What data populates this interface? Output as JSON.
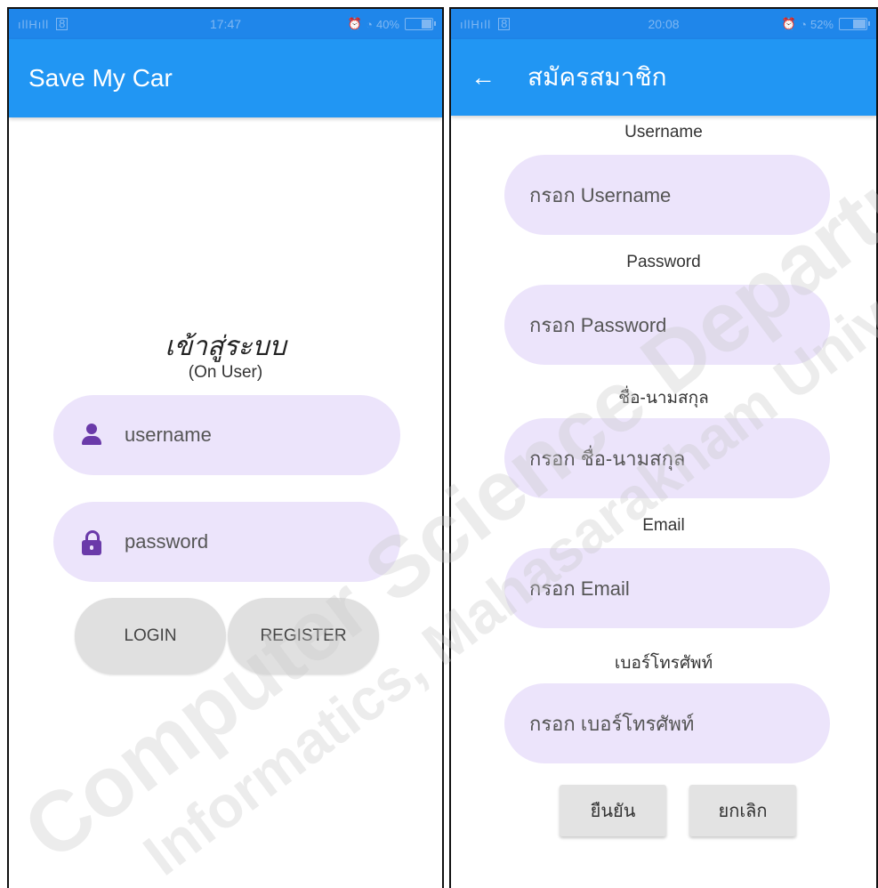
{
  "left_screen": {
    "status": {
      "signal": "H",
      "time": "17:47",
      "battery": "40%",
      "battery_level": 0.4
    },
    "appbar": {
      "title": "Save My Car"
    },
    "login": {
      "heading": "เข้าสู่ระบบ",
      "subheading": "(On User)",
      "username_placeholder": "username",
      "password_placeholder": "password",
      "login_button": "LOGIN",
      "register_button": "REGISTER"
    }
  },
  "right_screen": {
    "status": {
      "signal": "H",
      "time": "20:08",
      "battery": "52%",
      "battery_level": 0.52
    },
    "appbar": {
      "title": "สมัครสมาชิก"
    },
    "fields": [
      {
        "label": "Username",
        "placeholder": "กรอก Username"
      },
      {
        "label": "Password",
        "placeholder": "กรอก Password"
      },
      {
        "label": "ชื่อ-นามสกุล",
        "placeholder": "กรอก ชื่อ-นามสกุล"
      },
      {
        "label": "Email",
        "placeholder": "กรอก Email"
      },
      {
        "label": "เบอร์โทรศัพท์",
        "placeholder": "กรอก เบอร์โทรศัพท์"
      }
    ],
    "confirm_button": "ยืนยัน",
    "cancel_button": "ยกเลิก"
  },
  "watermark": {
    "line1": "Computer Science Department",
    "line2": "Informatics, Mahasarakham University"
  }
}
